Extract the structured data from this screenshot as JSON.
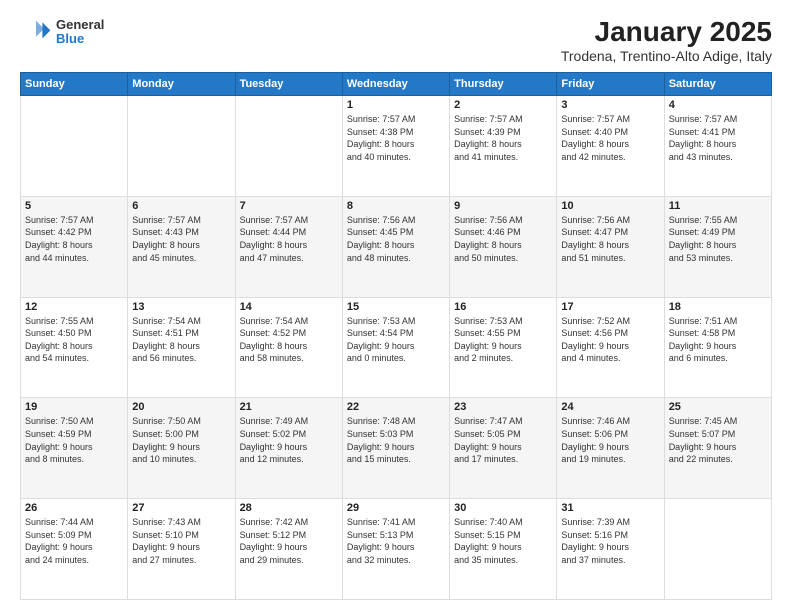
{
  "header": {
    "logo_general": "General",
    "logo_blue": "Blue",
    "title": "January 2025",
    "subtitle": "Trodena, Trentino-Alto Adige, Italy"
  },
  "calendar": {
    "weekdays": [
      "Sunday",
      "Monday",
      "Tuesday",
      "Wednesday",
      "Thursday",
      "Friday",
      "Saturday"
    ],
    "weeks": [
      [
        {
          "day": "",
          "info": ""
        },
        {
          "day": "",
          "info": ""
        },
        {
          "day": "",
          "info": ""
        },
        {
          "day": "1",
          "info": "Sunrise: 7:57 AM\nSunset: 4:38 PM\nDaylight: 8 hours\nand 40 minutes."
        },
        {
          "day": "2",
          "info": "Sunrise: 7:57 AM\nSunset: 4:39 PM\nDaylight: 8 hours\nand 41 minutes."
        },
        {
          "day": "3",
          "info": "Sunrise: 7:57 AM\nSunset: 4:40 PM\nDaylight: 8 hours\nand 42 minutes."
        },
        {
          "day": "4",
          "info": "Sunrise: 7:57 AM\nSunset: 4:41 PM\nDaylight: 8 hours\nand 43 minutes."
        }
      ],
      [
        {
          "day": "5",
          "info": "Sunrise: 7:57 AM\nSunset: 4:42 PM\nDaylight: 8 hours\nand 44 minutes."
        },
        {
          "day": "6",
          "info": "Sunrise: 7:57 AM\nSunset: 4:43 PM\nDaylight: 8 hours\nand 45 minutes."
        },
        {
          "day": "7",
          "info": "Sunrise: 7:57 AM\nSunset: 4:44 PM\nDaylight: 8 hours\nand 47 minutes."
        },
        {
          "day": "8",
          "info": "Sunrise: 7:56 AM\nSunset: 4:45 PM\nDaylight: 8 hours\nand 48 minutes."
        },
        {
          "day": "9",
          "info": "Sunrise: 7:56 AM\nSunset: 4:46 PM\nDaylight: 8 hours\nand 50 minutes."
        },
        {
          "day": "10",
          "info": "Sunrise: 7:56 AM\nSunset: 4:47 PM\nDaylight: 8 hours\nand 51 minutes."
        },
        {
          "day": "11",
          "info": "Sunrise: 7:55 AM\nSunset: 4:49 PM\nDaylight: 8 hours\nand 53 minutes."
        }
      ],
      [
        {
          "day": "12",
          "info": "Sunrise: 7:55 AM\nSunset: 4:50 PM\nDaylight: 8 hours\nand 54 minutes."
        },
        {
          "day": "13",
          "info": "Sunrise: 7:54 AM\nSunset: 4:51 PM\nDaylight: 8 hours\nand 56 minutes."
        },
        {
          "day": "14",
          "info": "Sunrise: 7:54 AM\nSunset: 4:52 PM\nDaylight: 8 hours\nand 58 minutes."
        },
        {
          "day": "15",
          "info": "Sunrise: 7:53 AM\nSunset: 4:54 PM\nDaylight: 9 hours\nand 0 minutes."
        },
        {
          "day": "16",
          "info": "Sunrise: 7:53 AM\nSunset: 4:55 PM\nDaylight: 9 hours\nand 2 minutes."
        },
        {
          "day": "17",
          "info": "Sunrise: 7:52 AM\nSunset: 4:56 PM\nDaylight: 9 hours\nand 4 minutes."
        },
        {
          "day": "18",
          "info": "Sunrise: 7:51 AM\nSunset: 4:58 PM\nDaylight: 9 hours\nand 6 minutes."
        }
      ],
      [
        {
          "day": "19",
          "info": "Sunrise: 7:50 AM\nSunset: 4:59 PM\nDaylight: 9 hours\nand 8 minutes."
        },
        {
          "day": "20",
          "info": "Sunrise: 7:50 AM\nSunset: 5:00 PM\nDaylight: 9 hours\nand 10 minutes."
        },
        {
          "day": "21",
          "info": "Sunrise: 7:49 AM\nSunset: 5:02 PM\nDaylight: 9 hours\nand 12 minutes."
        },
        {
          "day": "22",
          "info": "Sunrise: 7:48 AM\nSunset: 5:03 PM\nDaylight: 9 hours\nand 15 minutes."
        },
        {
          "day": "23",
          "info": "Sunrise: 7:47 AM\nSunset: 5:05 PM\nDaylight: 9 hours\nand 17 minutes."
        },
        {
          "day": "24",
          "info": "Sunrise: 7:46 AM\nSunset: 5:06 PM\nDaylight: 9 hours\nand 19 minutes."
        },
        {
          "day": "25",
          "info": "Sunrise: 7:45 AM\nSunset: 5:07 PM\nDaylight: 9 hours\nand 22 minutes."
        }
      ],
      [
        {
          "day": "26",
          "info": "Sunrise: 7:44 AM\nSunset: 5:09 PM\nDaylight: 9 hours\nand 24 minutes."
        },
        {
          "day": "27",
          "info": "Sunrise: 7:43 AM\nSunset: 5:10 PM\nDaylight: 9 hours\nand 27 minutes."
        },
        {
          "day": "28",
          "info": "Sunrise: 7:42 AM\nSunset: 5:12 PM\nDaylight: 9 hours\nand 29 minutes."
        },
        {
          "day": "29",
          "info": "Sunrise: 7:41 AM\nSunset: 5:13 PM\nDaylight: 9 hours\nand 32 minutes."
        },
        {
          "day": "30",
          "info": "Sunrise: 7:40 AM\nSunset: 5:15 PM\nDaylight: 9 hours\nand 35 minutes."
        },
        {
          "day": "31",
          "info": "Sunrise: 7:39 AM\nSunset: 5:16 PM\nDaylight: 9 hours\nand 37 minutes."
        },
        {
          "day": "",
          "info": ""
        }
      ]
    ]
  }
}
